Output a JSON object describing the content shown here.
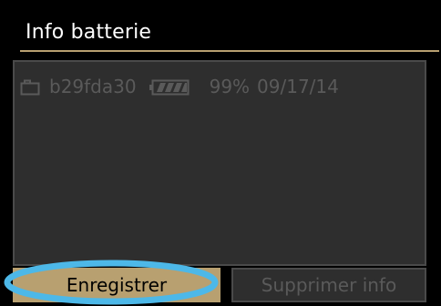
{
  "header": {
    "title": "Info batterie"
  },
  "battery_list": [
    {
      "icon": "camera-icon",
      "name": "b29fda30",
      "battery_icon": "battery-full-icon",
      "level": "99%",
      "date": "09/17/14"
    }
  ],
  "buttons": {
    "save_label": "Enregistrer",
    "delete_label": "Supprimer info"
  },
  "colors": {
    "accent": "#b8a070",
    "highlight_ring": "#4db8e8",
    "panel": "#2e2e2e",
    "disabled_text": "#5a5a5a"
  }
}
